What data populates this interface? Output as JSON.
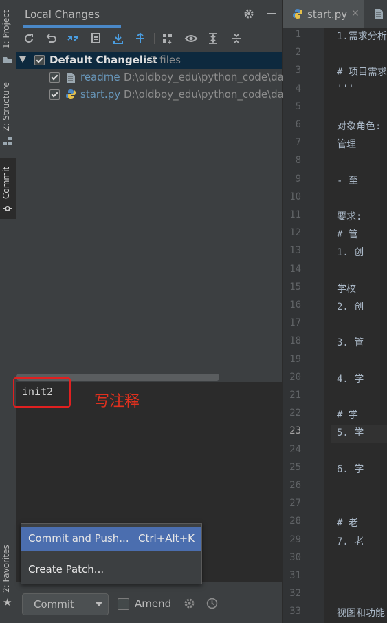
{
  "left_strip": {
    "project_label": "1: Project",
    "structure_label": "Z: Structure",
    "commit_label": "Commit",
    "favorites_label": "2: Favorites"
  },
  "panel": {
    "tab_label": "Local Changes",
    "changelist": {
      "name": "Default Changelist",
      "count": "2 files"
    },
    "files": [
      {
        "name": "readme",
        "path": "D:\\oldboy_edu\\python_code\\da"
      },
      {
        "name": "start.py",
        "path": "D:\\oldboy_edu\\python_code\\da"
      }
    ],
    "commit_message": "init2",
    "annotation": "写注释",
    "popup": {
      "commit_and_push": "Commit and Push...",
      "shortcut": "Ctrl+Alt+K",
      "create_patch": "Create Patch..."
    },
    "commit_button": "Commit",
    "amend_label": "Amend"
  },
  "editor": {
    "tab_label": "start.py",
    "line_numbers": [
      "1",
      "2",
      "3",
      "4",
      "5",
      "6",
      "7",
      "8",
      "9",
      "10",
      "11",
      "12",
      "13",
      "14",
      "15",
      "16",
      "17",
      "18",
      "19",
      "20",
      "21",
      "22",
      "23",
      "24",
      "25",
      "26",
      "27",
      "28",
      "29",
      "30",
      "31",
      "32",
      "33"
    ],
    "code_lines": [
      "1.需求分析",
      "",
      "# 项目需求",
      "'''",
      "",
      "对象角色:",
      "    管理",
      "",
      "    - 至",
      "",
      "要求:",
      "    # 管",
      "   1. 创",
      "",
      "    学校",
      "   2. 创",
      "",
      "   3. 管",
      "",
      "   4. 学",
      "",
      "    # 学",
      "   5. 学",
      "",
      "   6. 学",
      "",
      "",
      "    # 老",
      "   7. 老",
      "",
      "",
      "",
      "视图和功能"
    ],
    "current_line": "23"
  },
  "colors": {
    "accent": "#4a88c7",
    "selection": "#4b6eaf",
    "annotation": "#e0301e"
  }
}
